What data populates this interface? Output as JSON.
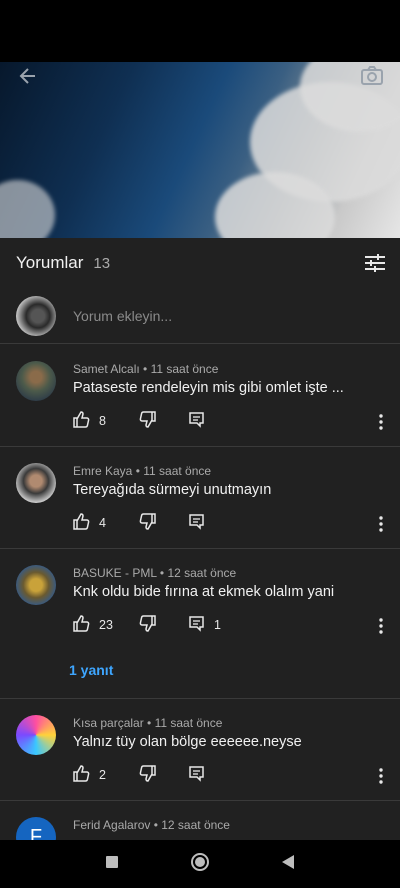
{
  "comments_header": {
    "title": "Yorumlar",
    "count": "13"
  },
  "add_comment": {
    "placeholder": "Yorum ekleyin..."
  },
  "comments": [
    {
      "author": "Samet Alcalı",
      "time": "11 saat önce",
      "text": "Pataseste rendeleyin mis gibi omlet işte ...",
      "likes": "8",
      "replies": ""
    },
    {
      "author": "Emre Kaya",
      "time": "11 saat önce",
      "text": "Tereyağıda sürmeyi unutmayın",
      "likes": "4",
      "replies": ""
    },
    {
      "author": "BASUKE - PML",
      "time": "12 saat önce",
      "text": "Knk oldu bide fırına at ekmek olalım yani",
      "likes": "23",
      "replies": "1",
      "reply_link": "1 yanıt"
    },
    {
      "author": "Kısa parçalar",
      "time": "11 saat önce",
      "text": "Yalnız tüy olan bölge eeeeee.neyse",
      "likes": "2",
      "replies": ""
    },
    {
      "author": "Ferid Agalarov",
      "time": "12 saat önce",
      "avatar_letter": "F"
    }
  ],
  "colors": {
    "background": "#212121",
    "accent": "#3ea6ff",
    "divider": "#3a3a3a",
    "avatar_f": "#1565c0"
  },
  "icons": [
    "back-arrow-icon",
    "camera-icon",
    "filter-icon",
    "thumb-up-icon",
    "thumb-down-icon",
    "reply-icon",
    "more-vert-icon",
    "stop-icon",
    "home-icon",
    "back-triangle-icon"
  ]
}
